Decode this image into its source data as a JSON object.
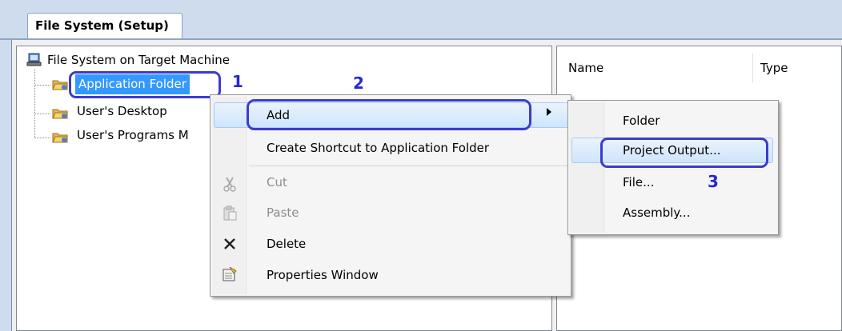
{
  "tab": {
    "title": "File System (Setup)"
  },
  "tree": {
    "root_label": "File System on Target Machine",
    "items": [
      {
        "label": "Application Folder",
        "selected": true
      },
      {
        "label": "User's Desktop"
      },
      {
        "label": "User's Programs M"
      }
    ]
  },
  "list": {
    "columns": [
      "Name",
      "Type"
    ]
  },
  "context_menu": {
    "items": [
      {
        "label": "Add",
        "has_submenu": true,
        "highlighted": true
      },
      {
        "label": "Create Shortcut to Application Folder"
      },
      {
        "label": "Cut",
        "disabled": true,
        "icon": "scissors-icon"
      },
      {
        "label": "Paste",
        "disabled": true,
        "icon": "clipboard-icon"
      },
      {
        "label": "Delete",
        "icon": "delete-x-icon"
      },
      {
        "label": "Properties Window",
        "icon": "properties-icon"
      }
    ]
  },
  "submenu": {
    "items": [
      {
        "label": "Folder"
      },
      {
        "label": "Project Output...",
        "highlighted": true
      },
      {
        "label": "File..."
      },
      {
        "label": "Assembly..."
      }
    ]
  },
  "annotations": [
    "1",
    "2",
    "3"
  ],
  "colors": {
    "annotation": "#2828d0",
    "selection": "#3399ff",
    "tab_bg": "#cfdcee"
  }
}
